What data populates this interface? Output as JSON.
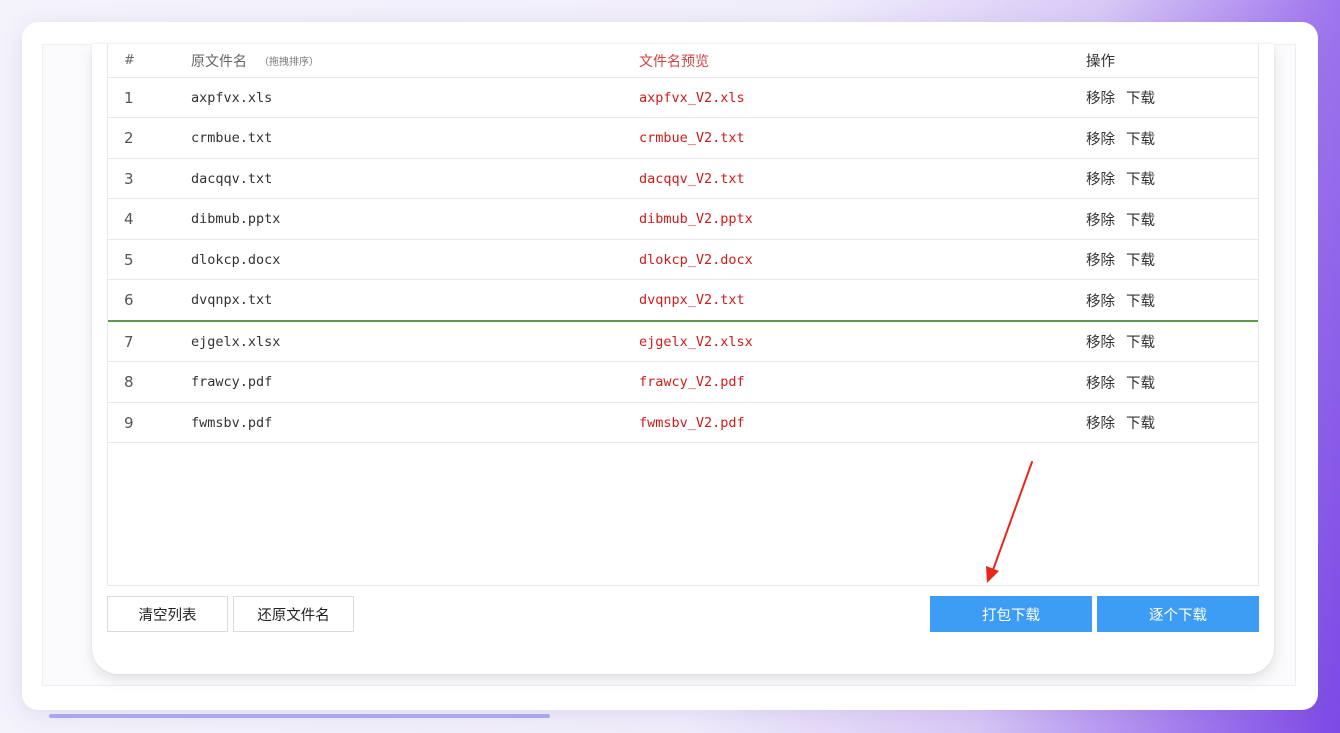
{
  "table": {
    "headers": {
      "index": "#",
      "original": "原文件名",
      "original_hint": "（拖拽排序）",
      "preview": "文件名预览",
      "actions": "操作"
    },
    "rows": [
      {
        "index": "1",
        "original": "axpfvx.xls",
        "preview": "axpfvx_V2.xls",
        "remove": "移除",
        "download": "下载"
      },
      {
        "index": "2",
        "original": "crmbue.txt",
        "preview": "crmbue_V2.txt",
        "remove": "移除",
        "download": "下载"
      },
      {
        "index": "3",
        "original": "dacqqv.txt",
        "preview": "dacqqv_V2.txt",
        "remove": "移除",
        "download": "下载"
      },
      {
        "index": "4",
        "original": "dibmub.pptx",
        "preview": "dibmub_V2.pptx",
        "remove": "移除",
        "download": "下载"
      },
      {
        "index": "5",
        "original": "dlokcp.docx",
        "preview": "dlokcp_V2.docx",
        "remove": "移除",
        "download": "下载"
      },
      {
        "index": "6",
        "original": "dvqnpx.txt",
        "preview": "dvqnpx_V2.txt",
        "remove": "移除",
        "download": "下载"
      },
      {
        "index": "7",
        "original": "ejgelx.xlsx",
        "preview": "ejgelx_V2.xlsx",
        "remove": "移除",
        "download": "下载"
      },
      {
        "index": "8",
        "original": "frawcy.pdf",
        "preview": "frawcy_V2.pdf",
        "remove": "移除",
        "download": "下载"
      },
      {
        "index": "9",
        "original": "fwmsbv.pdf",
        "preview": "fwmsbv_V2.pdf",
        "remove": "移除",
        "download": "下载"
      }
    ],
    "drag_over_row": 6
  },
  "buttons": {
    "clear_list": "清空列表",
    "restore_names": "还原文件名",
    "pack_download": "打包下载",
    "download_each": "逐个下载"
  },
  "colors": {
    "preview_text": "#d01b1b",
    "primary_button": "#3d9df5",
    "drag_indicator": "#5f9a4b",
    "annotation_arrow": "#e8261c"
  },
  "annotation": "arrow-pointing-to-pack-download"
}
